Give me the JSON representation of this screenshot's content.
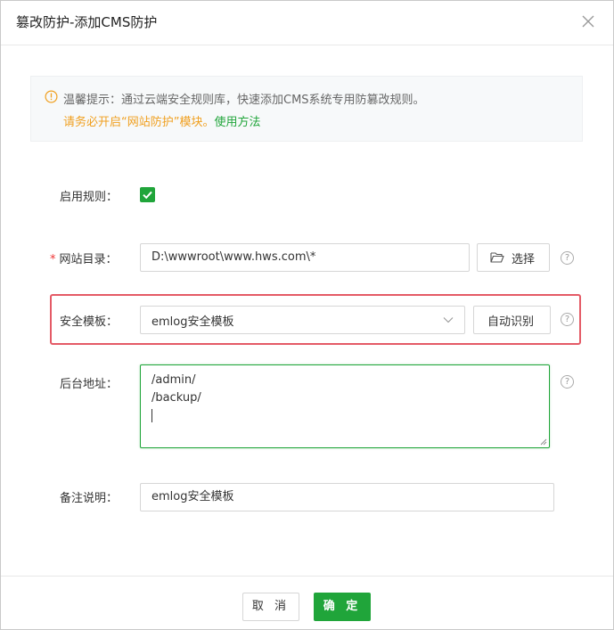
{
  "dialog": {
    "title": "篡改防护-添加CMS防护"
  },
  "notice": {
    "line1": "温馨提示：通过云端安全规则库，快速添加CMS系统专用防篡改规则。",
    "line2": "请务必开启“网站防护”模块。",
    "link": "使用方法"
  },
  "form": {
    "enable_rule": {
      "label": "启用规则：",
      "checked": true
    },
    "site_dir": {
      "required_mark": "*",
      "label": "网站目录：",
      "value": "D:\\wwwroot\\www.hws.com\\*",
      "select_button": "选择"
    },
    "template": {
      "label": "安全模板：",
      "value": "emlog安全模板",
      "auto_button": "自动识别"
    },
    "backend": {
      "label": "后台地址：",
      "lines": [
        "/admin/",
        "/backup/"
      ]
    },
    "remark": {
      "label": "备注说明：",
      "value": "emlog安全模板"
    },
    "help_glyph": "?"
  },
  "footer": {
    "cancel": "取 消",
    "confirm": "确 定"
  },
  "colors": {
    "accent": "#20a53a",
    "warning": "#f0a020",
    "highlight_border": "#e45a66",
    "required": "#ee3333"
  },
  "icons": {
    "close": "close-icon",
    "notice": "info-circle-icon",
    "check": "check-icon",
    "folder": "folder-open-icon",
    "chevron": "chevron-down-icon",
    "help": "question-circle-icon"
  }
}
